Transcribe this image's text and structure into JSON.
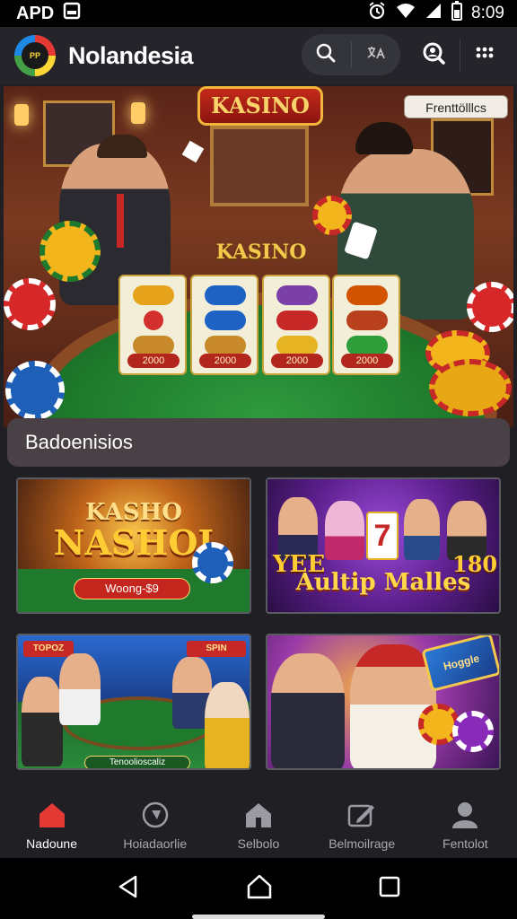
{
  "status_bar": {
    "carrier": "APD",
    "time": "8:09"
  },
  "header": {
    "logo_text": "PP",
    "title": "Nolandesia",
    "icons": [
      "search-icon",
      "translate-icon",
      "search-person-icon",
      "more-icon"
    ]
  },
  "hero": {
    "sign": "KASINO",
    "badge": "Frenttölllcs",
    "felt_title": "KASINO",
    "slots": [
      {
        "price": "2000"
      },
      {
        "price": "2000"
      },
      {
        "price": "2000"
      },
      {
        "price": "2000"
      }
    ]
  },
  "section": {
    "title": "Badoenisios"
  },
  "cards": [
    {
      "headline_top": "KASHO",
      "headline_bottom": "NASHOI",
      "pill": "Woong-$9"
    },
    {
      "headline_left": "YEE",
      "headline_main": "Aultip Malles",
      "headline_right": "180"
    },
    {
      "banner_left": "TOPOZ",
      "banner_right": "SPIN",
      "pill": "Tenoolioscaliz"
    },
    {
      "banner": "Hoggle"
    }
  ],
  "bottom_nav": [
    {
      "label": "Nadoune",
      "icon": "home-icon",
      "active": true
    },
    {
      "label": "Hoiadaorlie",
      "icon": "compass-icon",
      "active": false
    },
    {
      "label": "Selbolo",
      "icon": "house-icon",
      "active": false
    },
    {
      "label": "Belmoilrage",
      "icon": "edit-icon",
      "active": false
    },
    {
      "label": "Fentolot",
      "icon": "person-icon",
      "active": false
    }
  ],
  "system_nav": [
    "back-icon",
    "home-circle-icon",
    "recents-icon"
  ],
  "colors": {
    "accent": "#e53935",
    "felt": "#1e7a2c",
    "gold": "#f2c94c"
  }
}
